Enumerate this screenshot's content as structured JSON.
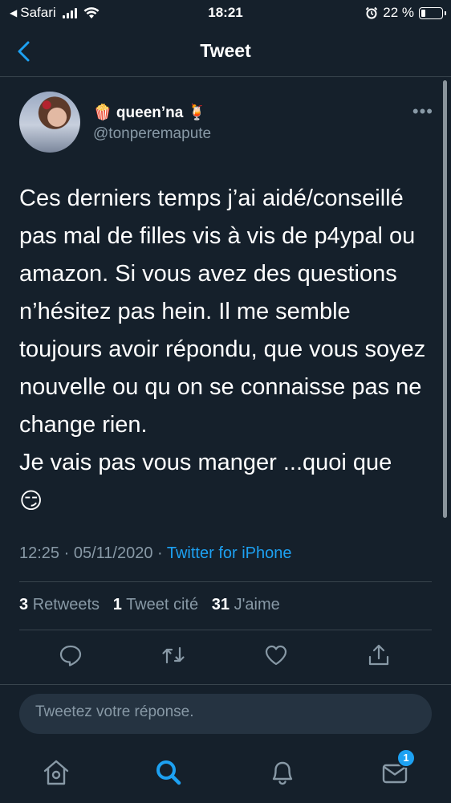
{
  "status_bar": {
    "carrier": "Safari",
    "time": "18:21",
    "battery_percent_label": "22 %",
    "battery_level": 0.22
  },
  "nav": {
    "title": "Tweet",
    "back_icon": "chevron-left-icon"
  },
  "tweet": {
    "display_name": "🍿 queen’na 🍹",
    "handle": "@tonperemapute",
    "text": "Ces derniers temps j’ai aidé/conseillé pas mal de filles vis à vis de p4ypal ou amazon. Si vous avez des questions n’hésitez pas hein. Il me semble toujours avoir répondu, que vous soyez nouvelle ou qu on se connaisse pas ne change rien.\nJe vais pas vous manger ...quoi que",
    "emoji": "😏",
    "timestamp": "12:25 · 05/11/2020 · ",
    "source": "Twitter for iPhone",
    "stats": {
      "retweets_count": "3",
      "retweets_label": "Retweets",
      "quotes_count": "1",
      "quotes_label": "Tweet cité",
      "likes_count": "31",
      "likes_label": "J'aime"
    },
    "actions": [
      "reply-icon",
      "retweet-icon",
      "like-icon",
      "share-icon"
    ]
  },
  "reply": {
    "placeholder": "Tweetez votre réponse."
  },
  "tabbar": {
    "tabs": [
      "home-icon",
      "search-icon",
      "notifications-icon",
      "messages-icon"
    ],
    "active": "search-icon",
    "messages_badge": "1"
  },
  "colors": {
    "background": "#15202b",
    "accent": "#1da1f2",
    "secondary_text": "#8899a6",
    "divider": "#38444d"
  }
}
